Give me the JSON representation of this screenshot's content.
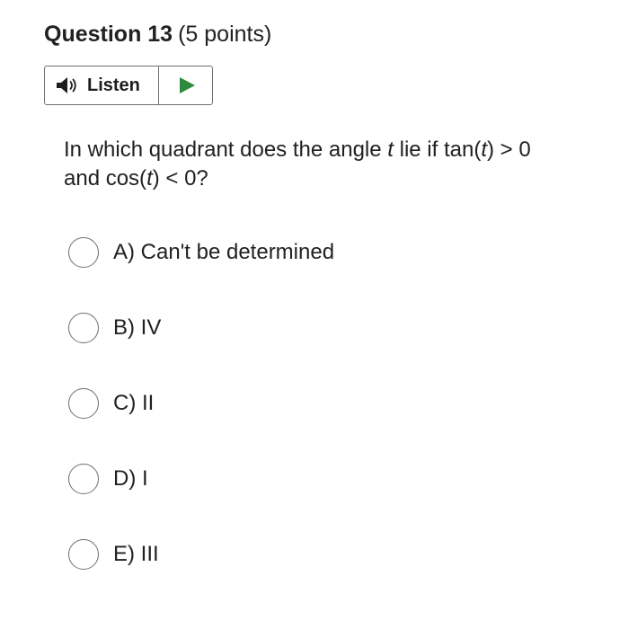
{
  "question": {
    "title": "Question 13",
    "points": "(5 points)",
    "text_part1": "In which quadrant does the angle ",
    "var1": "t",
    "text_part2": " lie if tan(",
    "var2": "t",
    "text_part3": ") > 0",
    "text_part4": "and cos(",
    "var3": "t",
    "text_part5": ") < 0?"
  },
  "listen": {
    "label": "Listen",
    "speaker_icon": "speaker-icon",
    "play_icon": "play-icon",
    "play_color": "#2e8b3e"
  },
  "options": [
    {
      "letter": "A)",
      "text": "Can't be determined"
    },
    {
      "letter": "B)",
      "text": "IV"
    },
    {
      "letter": "C)",
      "text": "II"
    },
    {
      "letter": "D)",
      "text": "I"
    },
    {
      "letter": "E)",
      "text": "III"
    }
  ]
}
